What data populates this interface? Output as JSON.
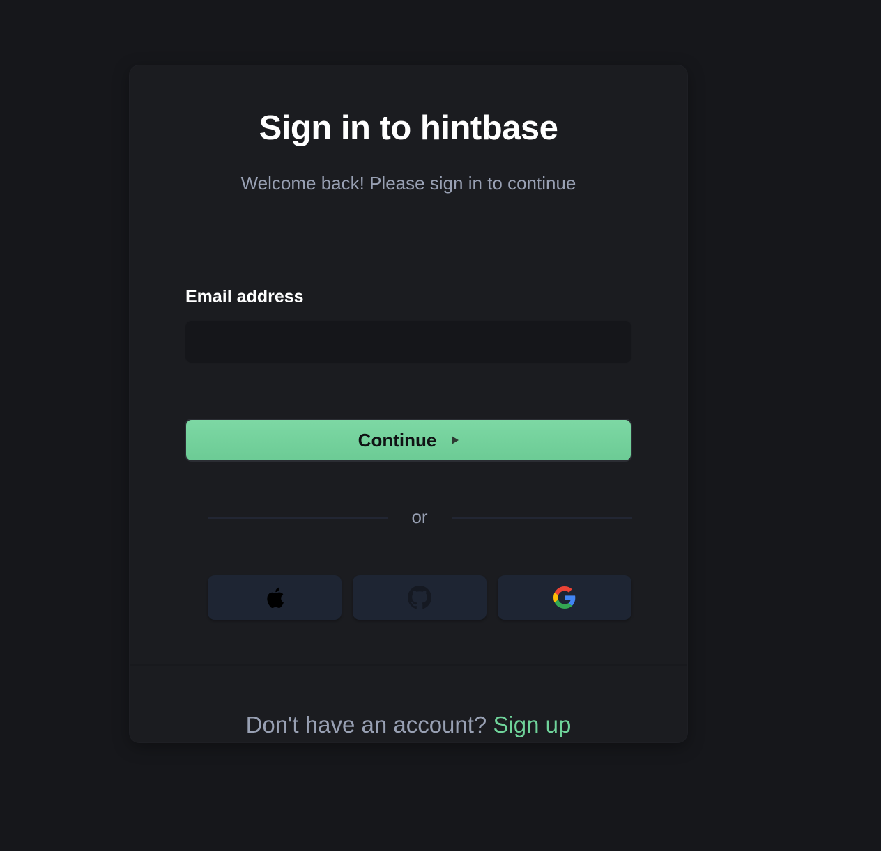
{
  "header": {
    "title": "Sign in to hintbase",
    "subtitle": "Welcome back! Please sign in to continue"
  },
  "form": {
    "email_label": "Email address",
    "email_value": "",
    "continue_label": "Continue"
  },
  "divider": {
    "text": "or"
  },
  "social": {
    "buttons": [
      {
        "provider": "Apple",
        "icon": "apple-icon"
      },
      {
        "provider": "GitHub",
        "icon": "github-icon"
      },
      {
        "provider": "Google",
        "icon": "google-icon"
      }
    ]
  },
  "footer": {
    "prompt": "Don't have an account?",
    "link_label": "Sign up"
  },
  "colors": {
    "background": "#16171b",
    "card": "#1b1c20",
    "accent": "#6fd39a",
    "muted_text": "#98a0b3",
    "social_button": "#1e2533"
  }
}
